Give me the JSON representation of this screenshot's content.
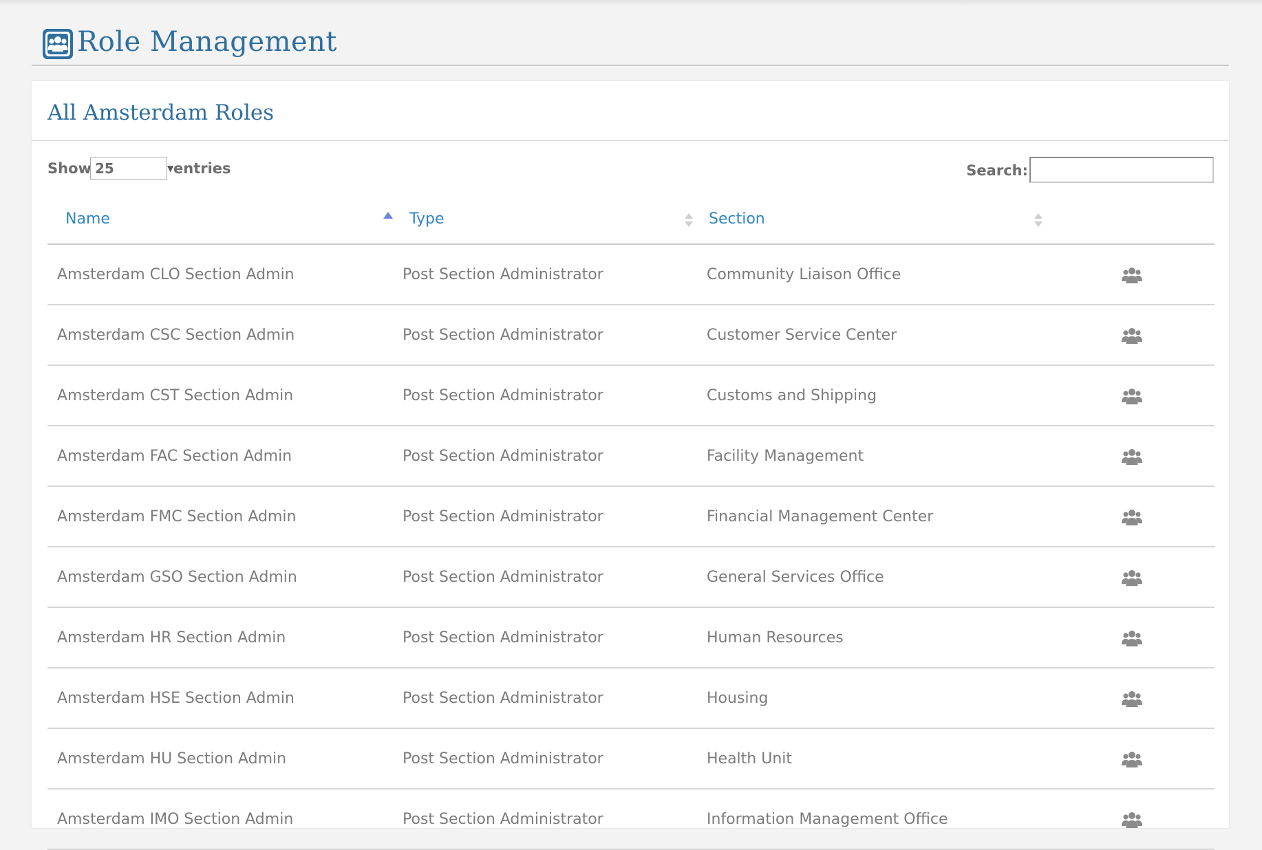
{
  "page": {
    "title": "Role Management",
    "logo_icon": "users-group-icon"
  },
  "panel": {
    "title": "All Amsterdam Roles",
    "length_control": {
      "prefix": "Show",
      "selected": "25",
      "suffix": "entries"
    },
    "search": {
      "label": "Search:",
      "value": ""
    }
  },
  "table": {
    "columns": [
      {
        "label": "Name",
        "sort": "ascending"
      },
      {
        "label": "Type",
        "sort": "none"
      },
      {
        "label": "Section",
        "sort": "none"
      },
      {
        "label": "",
        "sort": "none"
      }
    ],
    "rows": [
      {
        "name": "Amsterdam CLO Section Admin",
        "type": "Post Section Administrator",
        "section": "Community Liaison Office",
        "action_icon": "users-icon"
      },
      {
        "name": "Amsterdam CSC Section Admin",
        "type": "Post Section Administrator",
        "section": "Customer Service Center",
        "action_icon": "users-icon"
      },
      {
        "name": "Amsterdam CST Section Admin",
        "type": "Post Section Administrator",
        "section": "Customs and Shipping",
        "action_icon": "users-icon"
      },
      {
        "name": "Amsterdam FAC Section Admin",
        "type": "Post Section Administrator",
        "section": "Facility Management",
        "action_icon": "users-icon"
      },
      {
        "name": "Amsterdam FMC Section Admin",
        "type": "Post Section Administrator",
        "section": "Financial Management Center",
        "action_icon": "users-icon"
      },
      {
        "name": "Amsterdam GSO Section Admin",
        "type": "Post Section Administrator",
        "section": "General Services Office",
        "action_icon": "users-icon"
      },
      {
        "name": "Amsterdam HR Section Admin",
        "type": "Post Section Administrator",
        "section": "Human Resources",
        "action_icon": "users-icon"
      },
      {
        "name": "Amsterdam HSE Section Admin",
        "type": "Post Section Administrator",
        "section": "Housing",
        "action_icon": "users-icon"
      },
      {
        "name": "Amsterdam HU Section Admin",
        "type": "Post Section Administrator",
        "section": "Health Unit",
        "action_icon": "users-icon"
      },
      {
        "name": "Amsterdam IMO Section Admin",
        "type": "Post Section Administrator",
        "section": "Information Management Office",
        "action_icon": "users-icon"
      }
    ]
  },
  "colors": {
    "accent": "#2f6f9f",
    "header_link": "#2f86c4",
    "sort_active": "#6c86e0",
    "text": "#7c7c7c",
    "icon": "#8a8a8a",
    "background": "#f3f3f3"
  }
}
